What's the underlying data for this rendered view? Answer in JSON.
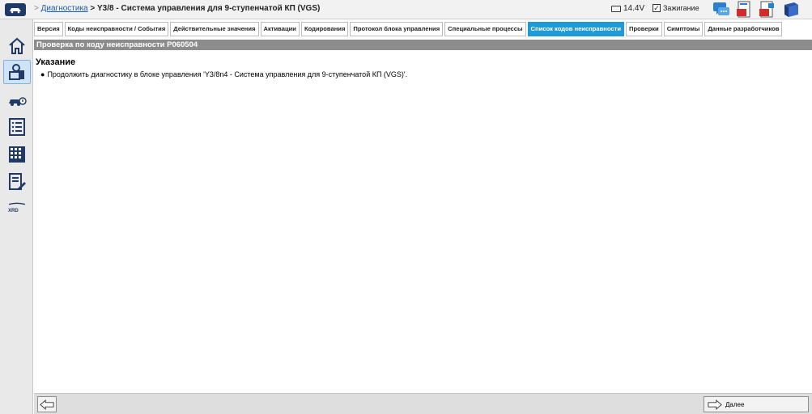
{
  "header": {
    "breadcrumb_prefix": ">",
    "breadcrumb_link": "Диагностика",
    "breadcrumb_separator": ">",
    "title": "Y3/8 - Система управления для 9-ступенчатой КП (VGS)",
    "voltage": "14.4V",
    "ignition_label": "Зажигание",
    "ignition_check": "✓"
  },
  "sidebar": {
    "items": [
      {
        "icon": "home-icon"
      },
      {
        "icon": "diagnosis-icon",
        "active": true
      },
      {
        "icon": "vehicle-info-icon"
      },
      {
        "icon": "list-icon"
      },
      {
        "icon": "grid-module-icon"
      },
      {
        "icon": "document-edit-icon"
      },
      {
        "icon": "xrd-icon"
      }
    ],
    "xrd_label": "XRD"
  },
  "tabs": [
    {
      "label": "Версия"
    },
    {
      "label": "Коды неисправности / События"
    },
    {
      "label": "Действительные значения"
    },
    {
      "label": "Активации"
    },
    {
      "label": "Кодирования"
    },
    {
      "label": "Протокол блока управления"
    },
    {
      "label": "Специальные процессы"
    },
    {
      "label": "Список кодов неисправности",
      "active": true
    },
    {
      "label": "Проверки"
    },
    {
      "label": "Симптомы"
    },
    {
      "label": "Данные разработчиков"
    }
  ],
  "section": {
    "title": "Проверка по коду неисправности P060504"
  },
  "content": {
    "notice_title": "Указание",
    "bullet": "●",
    "notice_text": "Продолжить диагностику в блоке управления 'Y3/8n4 - Система управления для 9-ступенчатой КП (VGS)'."
  },
  "footer": {
    "next_label": "Далее"
  },
  "colors": {
    "active_tab": "#1e9ad6",
    "section_bar": "#8c8c8c",
    "link": "#1a5ea8"
  }
}
